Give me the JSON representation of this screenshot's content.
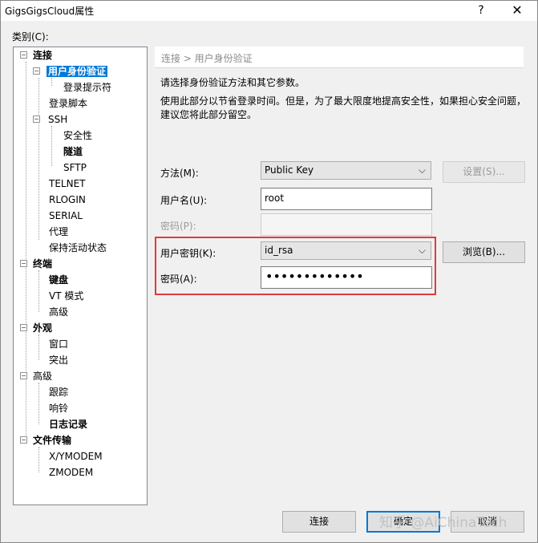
{
  "window": {
    "title": "GigsGigsCloud属性",
    "help_glyph": "?",
    "close_glyph": "✕"
  },
  "category_label": "类别(C):",
  "tree": {
    "collapse_glyph": "−",
    "items": [
      "连接",
      "用户身份验证",
      "登录提示符",
      "登录脚本",
      "SSH",
      "安全性",
      "隧道",
      "SFTP",
      "TELNET",
      "RLOGIN",
      "SERIAL",
      "代理",
      "保持活动状态",
      "终端",
      "键盘",
      "VT 模式",
      "高级",
      "外观",
      "窗口",
      "突出",
      "高级",
      "跟踪",
      "响铃",
      "日志记录",
      "文件传输",
      "X/YMODEM",
      "ZMODEM"
    ]
  },
  "breadcrumb": "连接 > 用户身份验证",
  "description": {
    "line1": "请选择身份验证方法和其它参数。",
    "line2": "使用此部分以节省登录时间。但是，为了最大限度地提高安全性，如果担心安全问题，",
    "line3": "建议您将此部分留空。"
  },
  "form": {
    "method_label": "方法(M):",
    "method_value": "Public Key",
    "settings_button": "设置(S)...",
    "username_label": "用户名(U):",
    "username_value": "root",
    "password_label": "密码(P):",
    "password_value": "",
    "userkey_label": "用户密钥(K):",
    "userkey_value": "id_rsa",
    "browse_button": "浏览(B)...",
    "passphrase_label": "密码(A):",
    "passphrase_value": "•••••••••••••",
    "dropdown_glyph": "⌵"
  },
  "buttons": {
    "connect": "连接",
    "ok": "确定",
    "cancel": "取消"
  },
  "watermark": "知乎 @AiChinaTech",
  "colors": {
    "selection": "#0078d7",
    "highlight_box": "#e03b3b",
    "default_button_border": "#0078d7"
  }
}
